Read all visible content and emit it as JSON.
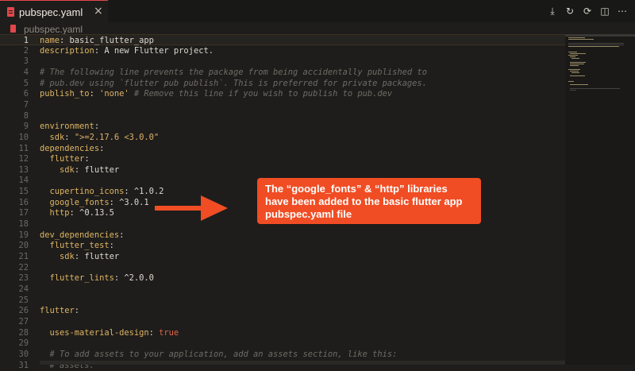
{
  "tab": {
    "label": "pubspec.yaml",
    "close": "×"
  },
  "breadcrumb": {
    "label": "pubspec.yaml"
  },
  "editor_actions": [
    {
      "name": "download-icon",
      "glyph": "⤓"
    },
    {
      "name": "sync-icon",
      "glyph": "↻"
    },
    {
      "name": "restart-icon",
      "glyph": "⟳"
    },
    {
      "name": "split-editor-icon",
      "glyph": "◫"
    },
    {
      "name": "more-icon",
      "glyph": "⋯"
    }
  ],
  "lines": [
    {
      "n": "1",
      "parts": [
        [
          "k",
          "name"
        ],
        [
          "t",
          ": basic_flutter_app"
        ]
      ]
    },
    {
      "n": "2",
      "parts": [
        [
          "k",
          "description"
        ],
        [
          "t",
          ": A new Flutter project."
        ]
      ]
    },
    {
      "n": "3",
      "parts": []
    },
    {
      "n": "4",
      "parts": [
        [
          "c",
          "# The following line prevents the package from being accidentally published to"
        ]
      ]
    },
    {
      "n": "5",
      "parts": [
        [
          "c",
          "# pub.dev using `flutter pub publish`. This is preferred for private packages."
        ]
      ]
    },
    {
      "n": "6",
      "parts": [
        [
          "k",
          "publish_to"
        ],
        [
          "t",
          ": "
        ],
        [
          "s",
          "'none'"
        ],
        [
          "c",
          " # Remove this line if you wish to publish to pub.dev"
        ]
      ]
    },
    {
      "n": "7",
      "parts": []
    },
    {
      "n": "8",
      "parts": []
    },
    {
      "n": "9",
      "parts": [
        [
          "k",
          "environment"
        ],
        [
          "t",
          ":"
        ]
      ]
    },
    {
      "n": "10",
      "parts": [
        [
          "t",
          "  "
        ],
        [
          "k",
          "sdk"
        ],
        [
          "t",
          ": "
        ],
        [
          "s",
          "\">=2.17.6 <3.0.0\""
        ]
      ]
    },
    {
      "n": "11",
      "parts": [
        [
          "k",
          "dependencies"
        ],
        [
          "t",
          ":"
        ]
      ]
    },
    {
      "n": "12",
      "parts": [
        [
          "t",
          "  "
        ],
        [
          "k",
          "flutter"
        ],
        [
          "t",
          ":"
        ]
      ]
    },
    {
      "n": "13",
      "parts": [
        [
          "t",
          "    "
        ],
        [
          "k",
          "sdk"
        ],
        [
          "t",
          ": flutter"
        ]
      ]
    },
    {
      "n": "14",
      "parts": []
    },
    {
      "n": "15",
      "parts": [
        [
          "t",
          "  "
        ],
        [
          "k",
          "cupertino_icons"
        ],
        [
          "t",
          ": ^1.0.2"
        ]
      ]
    },
    {
      "n": "16",
      "parts": [
        [
          "t",
          "  "
        ],
        [
          "k",
          "google_fonts"
        ],
        [
          "t",
          ": ^3.0.1"
        ]
      ]
    },
    {
      "n": "17",
      "parts": [
        [
          "t",
          "  "
        ],
        [
          "k",
          "http"
        ],
        [
          "t",
          ": ^0.13.5"
        ]
      ]
    },
    {
      "n": "18",
      "parts": []
    },
    {
      "n": "19",
      "parts": [
        [
          "k",
          "dev_dependencies"
        ],
        [
          "t",
          ":"
        ]
      ]
    },
    {
      "n": "20",
      "parts": [
        [
          "t",
          "  "
        ],
        [
          "k",
          "flutter_test"
        ],
        [
          "t",
          ":"
        ]
      ]
    },
    {
      "n": "21",
      "parts": [
        [
          "t",
          "    "
        ],
        [
          "k",
          "sdk"
        ],
        [
          "t",
          ": flutter"
        ]
      ]
    },
    {
      "n": "22",
      "parts": []
    },
    {
      "n": "23",
      "parts": [
        [
          "t",
          "  "
        ],
        [
          "k",
          "flutter_lints"
        ],
        [
          "t",
          ": ^2.0.0"
        ]
      ]
    },
    {
      "n": "24",
      "parts": []
    },
    {
      "n": "25",
      "parts": []
    },
    {
      "n": "26",
      "parts": [
        [
          "k",
          "flutter"
        ],
        [
          "t",
          ":"
        ]
      ]
    },
    {
      "n": "27",
      "parts": []
    },
    {
      "n": "28",
      "parts": [
        [
          "t",
          "  "
        ],
        [
          "k",
          "uses-material-design"
        ],
        [
          "t",
          ": "
        ],
        [
          "b",
          "true"
        ]
      ]
    },
    {
      "n": "29",
      "parts": []
    },
    {
      "n": "30",
      "parts": [
        [
          "c",
          "  # To add assets to your application, add an assets section, like this:"
        ]
      ]
    },
    {
      "n": "31",
      "parts": [
        [
          "c",
          "  # assets:"
        ]
      ]
    }
  ],
  "callout": {
    "text": "The “google_fonts” & “http” libraries have been added to the basic flutter app pubspec.yaml file"
  },
  "colors": {
    "accent": "#f04d24",
    "tab_icon": "#e2474a",
    "key": "#dfb563",
    "comment": "#6f6c66",
    "boolean": "#e2644b"
  }
}
